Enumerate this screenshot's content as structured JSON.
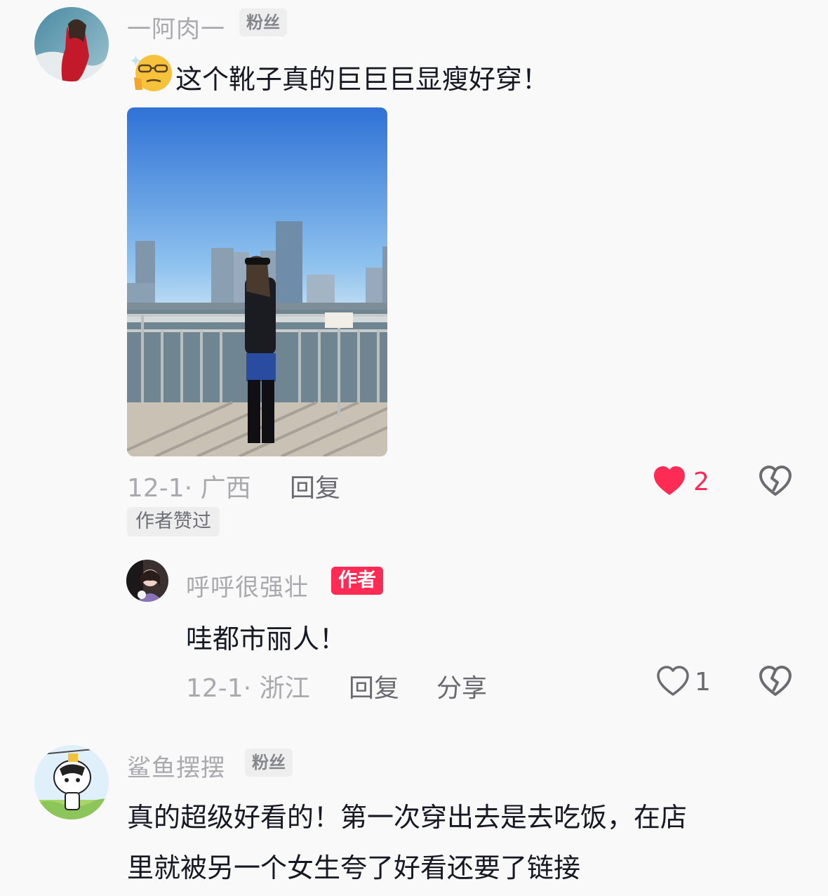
{
  "comments": [
    {
      "username": "一阿肉一",
      "badge": "粉丝",
      "text": "这个靴子真的巨巨巨显瘦好穿！",
      "emoji_icon": "thinking-glasses-emoji",
      "date_location": "12-1· 广西",
      "reply_label": "回复",
      "like_count": "2",
      "liked": true,
      "liked_by_author": "作者赞过"
    },
    {
      "username": "呼呼很强壮",
      "badge": "作者",
      "text": "哇都市丽人！",
      "date_location": "12-1· 浙江",
      "reply_label": "回复",
      "share_label": "分享",
      "like_count": "1",
      "liked": false
    },
    {
      "username": "鲨鱼摆摆",
      "badge": "粉丝",
      "text_line1": "真的超级好看的！第一次穿出去是去吃饭，在店",
      "text_line2": "里就被另一个女生夸了好看还要了链接"
    }
  ],
  "colors": {
    "accent_red": "#fe2c55",
    "text_primary": "#161823",
    "text_secondary": "#a9a9ae",
    "background": "#f9f9f9"
  },
  "icons": [
    "heart-filled-icon",
    "heart-outline-icon",
    "broken-heart-icon"
  ]
}
